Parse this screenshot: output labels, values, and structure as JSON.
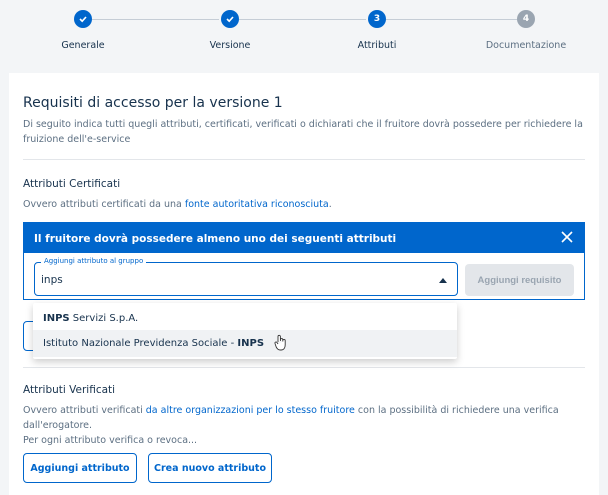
{
  "stepper": {
    "steps": [
      {
        "label": "Generale",
        "status": "done",
        "number": ""
      },
      {
        "label": "Versione",
        "status": "done",
        "number": ""
      },
      {
        "label": "Attributi",
        "status": "active",
        "number": "3"
      },
      {
        "label": "Documentazione",
        "status": "todo",
        "number": "4"
      }
    ]
  },
  "main": {
    "title": "Requisiti di accesso per la versione 1",
    "description": "Di seguito indica tutti quegli attributi, certificati, verificati o dichiarati che il fruitore dovrà possedere per richiedere la fruizione dell'e-service"
  },
  "certified": {
    "title": "Attributi Certificati",
    "desc_prefix": "Ovvero attributi certificati da una ",
    "desc_link": "fonte autoritativa riconosciuta",
    "desc_suffix": ".",
    "panel": {
      "header": "Il fruitore dovrà possedere almeno uno dei seguenti attributi",
      "field_label": "Aggiungi attributo al gruppo",
      "field_value": "inps",
      "add_button": "Aggiungi requisito"
    },
    "dropdown": [
      {
        "bold": "INPS",
        "rest": " Servizi S.p.A.",
        "prefix": ""
      },
      {
        "prefix": "Istituto Nazionale Previdenza Sociale - ",
        "bold": "INPS",
        "rest": ""
      }
    ]
  },
  "verified": {
    "title": "Attributi Verificati",
    "desc_prefix": "Ovvero attributi verificati ",
    "desc_link": "da altre organizzazioni per lo stesso fruitore",
    "desc_suffix": " con la possibilità di richiedere una verifica dall'erogatore.",
    "desc_line2": "Per ogni attributo verifica o revoca...",
    "add_button": "Aggiungi attributo",
    "create_button": "Crea nuovo attributo"
  },
  "colors": {
    "primary": "#0066cc",
    "text": "#17324d",
    "muted": "#5c6f82",
    "background": "#f3f5f7"
  }
}
